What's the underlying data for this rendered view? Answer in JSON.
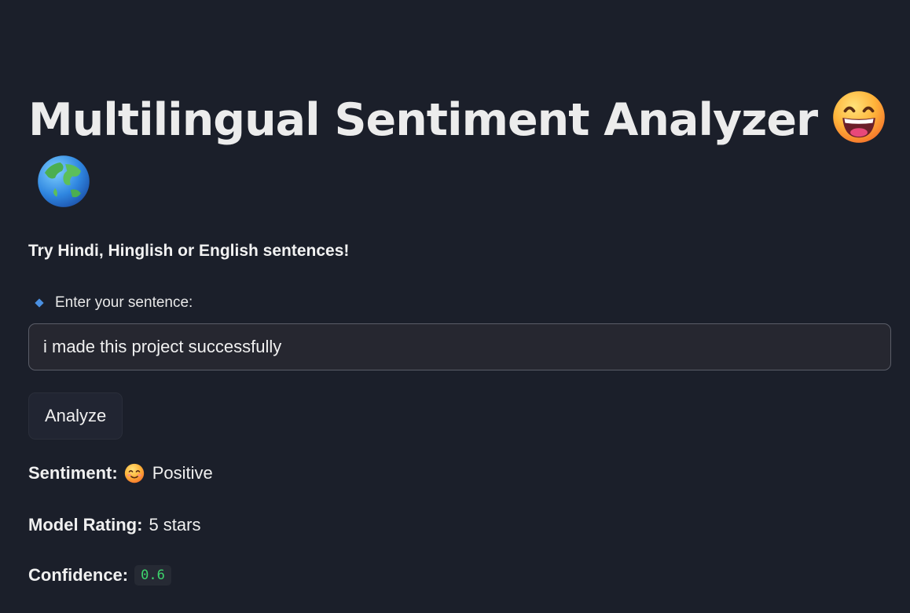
{
  "page": {
    "title": "Multilingual Sentiment Analyzer",
    "title_emojis": [
      "grinning-face-icon",
      "globe-asia-icon"
    ],
    "subtitle": "Try Hindi, Hinglish or English sentences!"
  },
  "input": {
    "label": "Enter your sentence:",
    "value": "i made this project successfully",
    "label_icon": "blue-diamond-icon"
  },
  "actions": {
    "analyze_label": "Analyze"
  },
  "results": {
    "sentiment_label": "Sentiment:",
    "sentiment_value": "Positive",
    "sentiment_icon": "smiling-face-icon",
    "rating_label": "Model Rating:",
    "rating_value": "5 stars",
    "confidence_label": "Confidence:",
    "confidence_value": "0.6"
  },
  "colors": {
    "background": "#1b1f2a",
    "input_bg": "#262730",
    "accent_blue": "#4a90e2",
    "code_green": "#3dd56d"
  }
}
